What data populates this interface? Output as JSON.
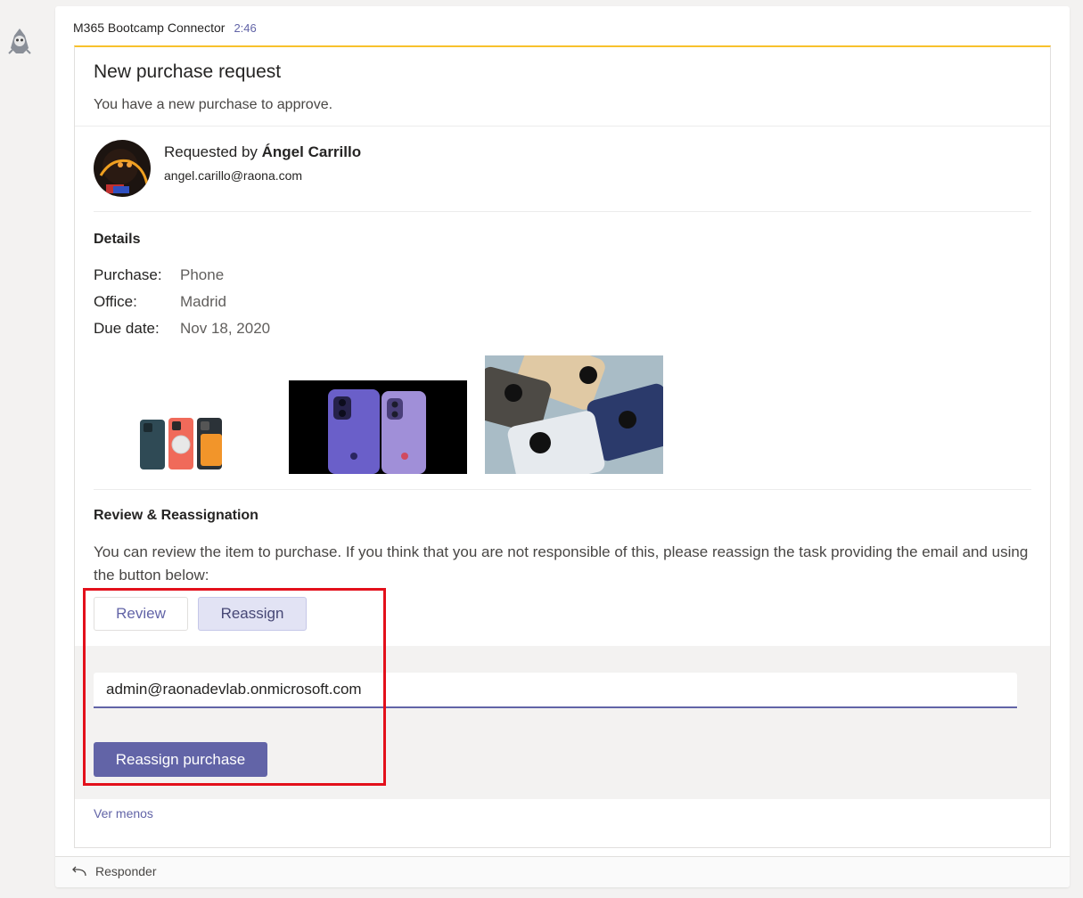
{
  "message": {
    "sender": "M365 Bootcamp Connector",
    "time": "2:46"
  },
  "card": {
    "title": "New purchase request",
    "subtitle": "You have a new purchase to approve.",
    "requested_prefix": "Requested by ",
    "requester_name": "Ángel Carrillo",
    "requester_email": "angel.carillo@raona.com",
    "details_title": "Details",
    "facts": [
      {
        "label": "Purchase:",
        "value": "Phone"
      },
      {
        "label": "Office:",
        "value": "Madrid"
      },
      {
        "label": "Due date:",
        "value": "Nov 18, 2020"
      }
    ],
    "review_title": "Review & Reassignation",
    "review_text": "You can review the item to purchase. If you think that you are not responsible of this, please reassign the task providing the email and using the button below:",
    "buttons": {
      "review": "Review",
      "reassign": "Reassign",
      "reassign_purchase": "Reassign purchase"
    },
    "reassign_email_value": "admin@raonadevlab.onmicrosoft.com",
    "see_less": "Ver menos"
  },
  "reply": {
    "label": "Responder"
  },
  "colors": {
    "accent": "#6264a7",
    "card_top_border": "#f8c12c",
    "highlight": "#e3101b"
  }
}
